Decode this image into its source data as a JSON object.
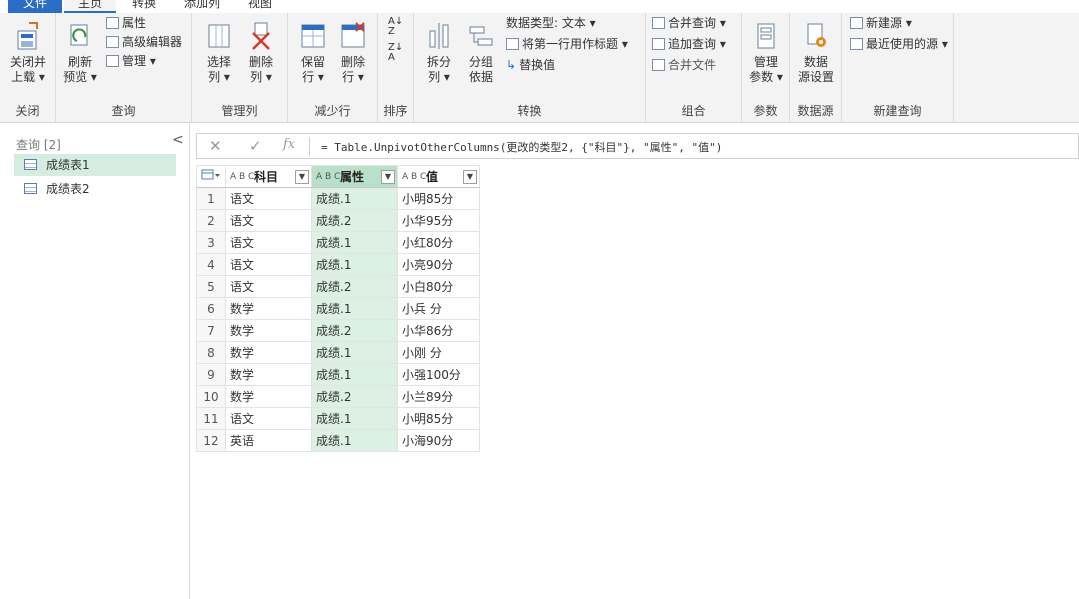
{
  "tabs": [
    "文件",
    "主页",
    "转换",
    "添加列",
    "视图"
  ],
  "ribbon": {
    "groups": [
      {
        "label": "关闭",
        "buttons": [
          "关闭并\n上载 ▾"
        ]
      },
      {
        "label": "查询",
        "refresh": "刷新\n预览 ▾",
        "small": [
          "属性",
          "高级编辑器",
          "管理 ▾"
        ]
      },
      {
        "label": "管理列",
        "buttons": [
          "选择\n列 ▾",
          "删除\n列 ▾"
        ]
      },
      {
        "label": "减少行",
        "buttons": [
          "保留\n行 ▾",
          "删除\n行 ▾"
        ]
      },
      {
        "label": "排序"
      },
      {
        "label": "转换",
        "buttons": [
          "拆分\n列 ▾",
          "分组\n依据"
        ],
        "small": [
          "数据类型: 文本 ▾",
          "将第一行用作标题 ▾",
          "替换值"
        ]
      },
      {
        "label": "组合",
        "small": [
          "合并查询 ▾",
          "追加查询 ▾",
          "合并文件"
        ]
      },
      {
        "label": "参数",
        "buttons": [
          "管理\n参数 ▾"
        ]
      },
      {
        "label": "数据源",
        "buttons": [
          "数据\n源设置"
        ]
      },
      {
        "label": "新建查询",
        "small": [
          "新建源 ▾",
          "最近使用的源 ▾"
        ]
      }
    ]
  },
  "queries": {
    "header": "查询 [2]",
    "items": [
      "成绩表1",
      "成绩表2"
    ]
  },
  "formula": {
    "cancel": "✕",
    "confirm": "✓",
    "fx": "fx",
    "text": "= Table.UnpivotOtherColumns(更改的类型2, {\"科目\"}, \"属性\", \"值\")"
  },
  "table": {
    "type_label": "A B C",
    "columns": [
      "科目",
      "属性",
      "值"
    ],
    "rows": [
      [
        "1",
        "语文",
        "成绩.1",
        "小明85分"
      ],
      [
        "2",
        "语文",
        "成绩.2",
        "小华95分"
      ],
      [
        "3",
        "语文",
        "成绩.1",
        "小红80分"
      ],
      [
        "4",
        "语文",
        "成绩.1",
        "小亮90分"
      ],
      [
        "5",
        "语文",
        "成绩.2",
        "小白80分"
      ],
      [
        "6",
        "数学",
        "成绩.1",
        "小兵 分"
      ],
      [
        "7",
        "数学",
        "成绩.2",
        "小华86分"
      ],
      [
        "8",
        "数学",
        "成绩.1",
        "小刚 分"
      ],
      [
        "9",
        "数学",
        "成绩.1",
        "小强100分"
      ],
      [
        "10",
        "数学",
        "成绩.2",
        "小兰89分"
      ],
      [
        "11",
        "语文",
        "成绩.1",
        "小明85分"
      ],
      [
        "12",
        "英语",
        "成绩.1",
        "小海90分"
      ]
    ]
  },
  "colors": {
    "accent": "#2b6cc4",
    "selected_column": "#dcf1e4",
    "selected_query": "#d4ede0"
  }
}
